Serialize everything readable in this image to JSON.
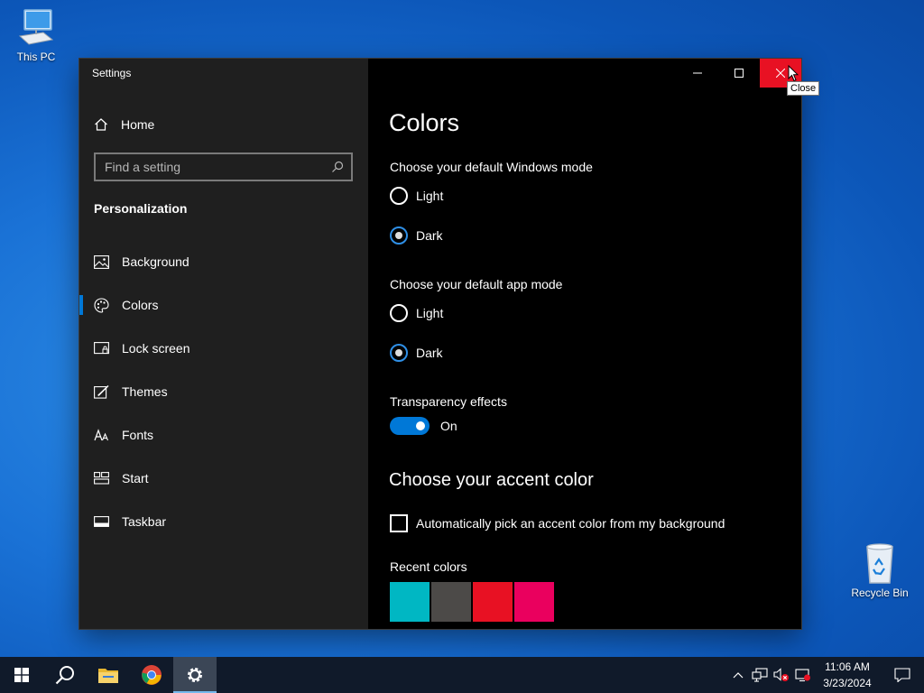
{
  "desktop": {
    "icons": [
      {
        "label": "This PC"
      },
      {
        "label": "Recycle Bin"
      }
    ]
  },
  "window": {
    "title": "Settings",
    "controls": {
      "close_tooltip": "Close"
    }
  },
  "sidebar": {
    "home_label": "Home",
    "search_placeholder": "Find a setting",
    "section_title": "Personalization",
    "items": [
      {
        "label": "Background",
        "icon": "image-icon"
      },
      {
        "label": "Colors",
        "icon": "palette-icon",
        "active": true
      },
      {
        "label": "Lock screen",
        "icon": "lock-screen-icon"
      },
      {
        "label": "Themes",
        "icon": "themes-icon"
      },
      {
        "label": "Fonts",
        "icon": "fonts-icon"
      },
      {
        "label": "Start",
        "icon": "start-icon"
      },
      {
        "label": "Taskbar",
        "icon": "taskbar-icon"
      }
    ]
  },
  "content": {
    "title": "Colors",
    "windows_mode": {
      "label": "Choose your default Windows mode",
      "options": [
        "Light",
        "Dark"
      ],
      "selected": "Dark"
    },
    "app_mode": {
      "label": "Choose your default app mode",
      "options": [
        "Light",
        "Dark"
      ],
      "selected": "Dark"
    },
    "transparency": {
      "label": "Transparency effects",
      "state": "On"
    },
    "accent_title": "Choose your accent color",
    "auto_accent_label": "Automatically pick an accent color from my background",
    "auto_accent_checked": false,
    "recent_colors_label": "Recent colors",
    "recent_colors": [
      "#00b7c3",
      "#4c4a48",
      "#e81123",
      "#ea005e"
    ]
  },
  "taskbar": {
    "clock_time": "11:06 AM",
    "clock_date": "3/23/2024"
  },
  "colors": {
    "accent": "#0078d7",
    "close_red": "#e81123"
  }
}
